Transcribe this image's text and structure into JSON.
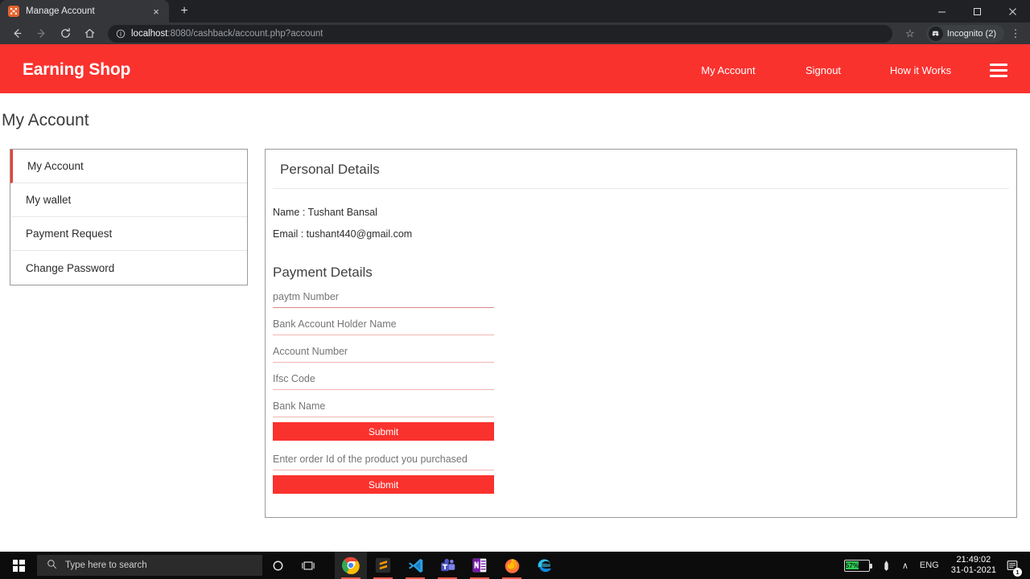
{
  "browser": {
    "tab": {
      "title": "Manage Account",
      "favicon": "orange-square-favicon",
      "close": "×"
    },
    "newtab_label": "+",
    "window_controls": {
      "minimize": "—",
      "maximize": "❐",
      "close": "✕"
    },
    "nav": {
      "back": "←",
      "forward": "→",
      "reload": "↻",
      "home": "⌂"
    },
    "omnibox": {
      "info_icon": "info-circle-icon",
      "url_host": "localhost",
      "url_rest": ":8080/cashback/account.php?account",
      "full_url": "localhost:8080/cashback/account.php?account"
    },
    "star_icon": "☆",
    "profile": {
      "label": "Incognito (2)",
      "icon": "incognito-icon"
    },
    "menu_icon": "⋮"
  },
  "site": {
    "brand": "Earning Shop",
    "accent_color": "#fa322e",
    "nav_links": [
      "My Account",
      "Signout",
      "How it Works"
    ],
    "hamburger": "menu-icon"
  },
  "page": {
    "title": "My Account"
  },
  "sidebar": {
    "items": [
      {
        "label": "My Account",
        "active": true
      },
      {
        "label": "My wallet",
        "active": false
      },
      {
        "label": "Payment Request",
        "active": false
      },
      {
        "label": "Change Password",
        "active": false
      }
    ]
  },
  "personal_details": {
    "heading": "Personal Details",
    "name_line": "Name : Tushant Bansal",
    "email_line": "Email : tushant440@gmail.com"
  },
  "payment_details": {
    "heading": "Payment Details",
    "fields": [
      {
        "placeholder": "paytm Number",
        "value": "",
        "emphasis": true
      },
      {
        "placeholder": "Bank Account Holder Name",
        "value": "",
        "emphasis": false
      },
      {
        "placeholder": "Account Number",
        "value": "",
        "emphasis": false
      },
      {
        "placeholder": "Ifsc Code",
        "value": "",
        "emphasis": false
      },
      {
        "placeholder": "Bank Name",
        "value": "",
        "emphasis": false
      }
    ],
    "submit_label": "Submit",
    "order_field": {
      "placeholder": "Enter order Id of the product you purchased",
      "value": ""
    },
    "order_submit_label": "Submit"
  },
  "taskbar": {
    "start_icon": "windows-logo-icon",
    "search_placeholder": "Type here to search",
    "search_icon": "search-icon",
    "cortana_icon": "cortana-circle-icon",
    "taskview_icon": "task-view-icon",
    "apps": [
      {
        "name": "chrome",
        "label": "Google Chrome"
      },
      {
        "name": "sublime-text",
        "label": "Sublime Text"
      },
      {
        "name": "vscode",
        "label": "Visual Studio Code"
      },
      {
        "name": "teams",
        "label": "Microsoft Teams"
      },
      {
        "name": "onenote",
        "label": "OneNote"
      },
      {
        "name": "firefox",
        "label": "Firefox"
      },
      {
        "name": "edge",
        "label": "Microsoft Edge"
      }
    ],
    "tray": {
      "battery_percent": "57%",
      "battery_level": 57,
      "pen_icon": "pen-icon",
      "chevron_up": "∧",
      "language": "ENG",
      "time": "21:49:02",
      "date": "31-01-2021",
      "notification_count": "1"
    }
  }
}
